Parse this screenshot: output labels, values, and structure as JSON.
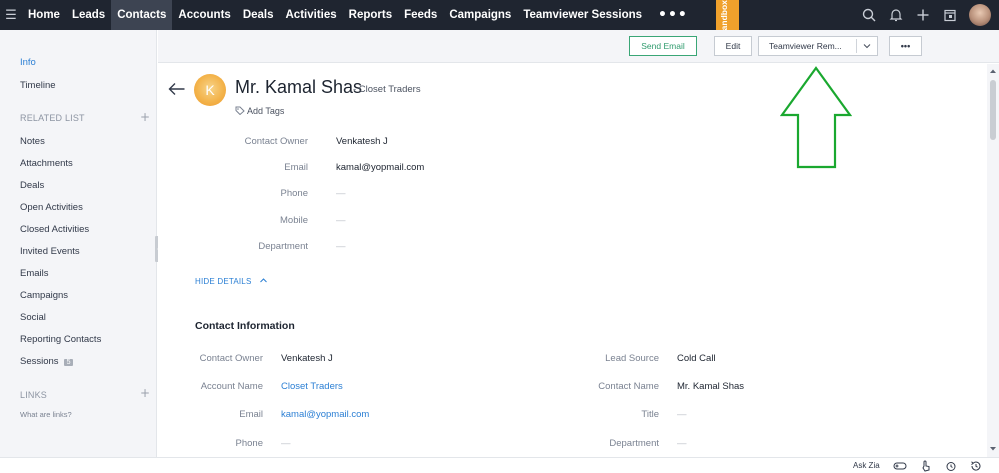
{
  "topnav": {
    "tabs": [
      "Home",
      "Leads",
      "Contacts",
      "Accounts",
      "Deals",
      "Activities",
      "Reports",
      "Feeds",
      "Campaigns",
      "Teamviewer Sessions"
    ],
    "active_tab": "Contacts",
    "more": "•••"
  },
  "sandbox_label": "Sandbox",
  "sidebar": {
    "info": "Info",
    "timeline": "Timeline",
    "related_header": "RELATED LIST",
    "plus": "+",
    "items": [
      "Notes",
      "Attachments",
      "Deals",
      "Open Activities",
      "Closed Activities",
      "Invited Events",
      "Emails",
      "Campaigns",
      "Social",
      "Reporting Contacts",
      "Sessions"
    ],
    "sessions_badge": "5",
    "links_header": "LINKS",
    "links_help": "What are links?"
  },
  "actionbar": {
    "send_email": "Send Email",
    "edit": "Edit",
    "teamviewer": "Teamviewer Rem...",
    "more": "•••"
  },
  "record": {
    "avatar_letter": "K",
    "name": "Mr. Kamal Shas",
    "company": "- Closet Traders",
    "add_tags": "Add Tags",
    "details": [
      {
        "label": "Contact Owner",
        "value": "Venkatesh J"
      },
      {
        "label": "Email",
        "value": "kamal@yopmail.com"
      },
      {
        "label": "Phone",
        "value": "—"
      },
      {
        "label": "Mobile",
        "value": "—"
      },
      {
        "label": "Department",
        "value": "—"
      }
    ],
    "hide_details": "HIDE DETAILS",
    "section_title": "Contact Information",
    "contact_left": [
      {
        "label": "Contact Owner",
        "value": "Venkatesh J"
      },
      {
        "label": "Account Name",
        "value": "Closet Traders"
      },
      {
        "label": "Email",
        "value": "kamal@yopmail.com"
      },
      {
        "label": "Phone",
        "value": "—"
      }
    ],
    "contact_right": [
      {
        "label": "Lead Source",
        "value": "Cold Call"
      },
      {
        "label": "Contact Name",
        "value": "Mr. Kamal Shas"
      },
      {
        "label": "Title",
        "value": "—"
      },
      {
        "label": "Department",
        "value": "—"
      }
    ]
  },
  "bottombar": {
    "ask_zia": "Ask Zia"
  },
  "colors": {
    "nav_bg": "#1f2530",
    "accent_blue": "#2b7fd4",
    "send_email_green": "#2f9b6d",
    "sandbox_orange": "#f0a12c",
    "annotation_arrow": "#1aa82f"
  }
}
